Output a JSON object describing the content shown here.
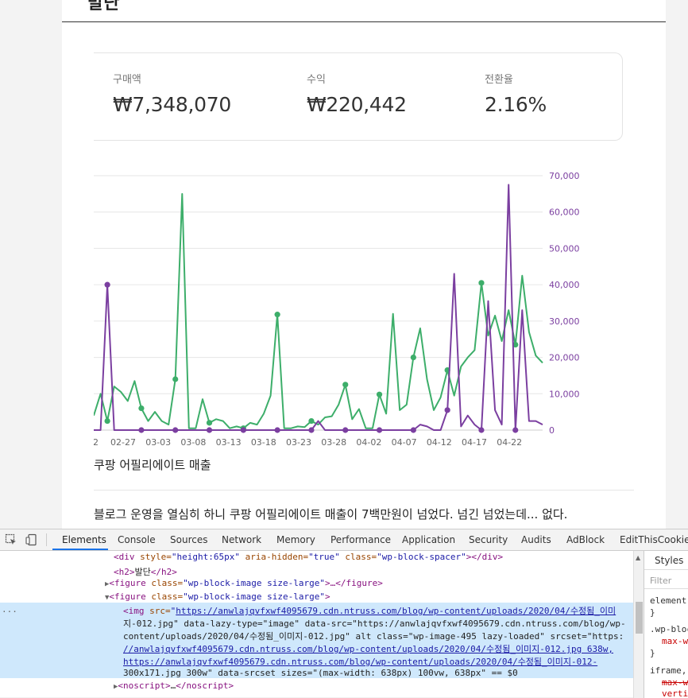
{
  "article": {
    "heading_partial": "발단",
    "stats": [
      {
        "label": "구매액",
        "value": "₩7,348,070"
      },
      {
        "label": "수익",
        "value": "₩220,442"
      },
      {
        "label": "전환율",
        "value": "2.16%"
      }
    ],
    "caption": "쿠팡 어필리에이트 매출",
    "paragraph": "블로그 운영을 열심히 하니 쿠팡 어필리에이트 매출이 7백만원이 넘었다. 넘긴 넘었는데... 없다."
  },
  "chart_data": {
    "type": "line",
    "x_ticks": [
      "2",
      "02-27",
      "03-03",
      "03-08",
      "03-13",
      "03-18",
      "03-23",
      "03-28",
      "04-02",
      "04-07",
      "04-12",
      "04-17",
      "04-22"
    ],
    "y_ticks": [
      "70,000",
      "60,000",
      "50,000",
      "40,000",
      "30,000",
      "20,000",
      "10,000",
      "0"
    ],
    "ylim": [
      0,
      70000
    ],
    "colors": {
      "green": "#3dae6a",
      "purple": "#7b3fa0",
      "tick": "#7b3fa0"
    },
    "series": [
      {
        "values": [
          4000,
          10000,
          2500,
          12000,
          10500,
          8000,
          13500,
          6000,
          2500,
          5000,
          2500,
          1500,
          14000,
          65000,
          500,
          500,
          8500,
          2000,
          3000,
          2500,
          500,
          1000,
          500,
          2000,
          1500,
          4500,
          9500,
          31800,
          500,
          500,
          1000,
          800,
          2500,
          1500,
          3500,
          3800,
          7000,
          12500,
          3000,
          5800,
          500,
          500,
          9800,
          4500,
          32000,
          5500,
          7000,
          20000,
          28000,
          14000,
          5500,
          9000,
          16500,
          9500,
          17500,
          20000,
          22000,
          40500,
          26000,
          31500,
          24500,
          33000,
          23500,
          42500,
          27000,
          20500,
          18500
        ]
      },
      {
        "values": [
          0,
          0,
          40000,
          0,
          0,
          0,
          0,
          0,
          0,
          0,
          0,
          0,
          0,
          0,
          0,
          0,
          0,
          0,
          0,
          0,
          0,
          0,
          0,
          0,
          0,
          0,
          0,
          0,
          0,
          0,
          0,
          0,
          0,
          2500,
          0,
          0,
          0,
          0,
          0,
          0,
          0,
          0,
          0,
          0,
          0,
          0,
          0,
          0,
          1500,
          1000,
          0,
          0,
          5500,
          43000,
          1000,
          4000,
          1500,
          0,
          35500,
          5500,
          1500,
          67500,
          0,
          33000,
          2500,
          2500,
          1500
        ]
      }
    ]
  },
  "devtools": {
    "tabs": [
      "Elements",
      "Console",
      "Sources",
      "Network",
      "Memory",
      "Performance",
      "Application",
      "Security",
      "Audits",
      "AdBlock",
      "EditThisCookie"
    ],
    "lines": [
      {
        "open": "<div ",
        "a1": "style=",
        "v1": "\"height:65px\"",
        "a2": " aria-hidden=",
        "v2": "\"true\"",
        "a3": " class=",
        "v3": "\"wp-block-spacer\"",
        "close": "></div>"
      },
      {
        "open": "<h2>",
        "text": "발단",
        "close": "</h2>"
      },
      {
        "arrow": "▶",
        "open": "<figure ",
        "a1": "class=",
        "v1": "\"wp-block-image size-large\"",
        "close": ">…</figure>"
      },
      {
        "arrow": "▼",
        "open": "<figure ",
        "a1": "class=",
        "v1": "\"wp-block-image size-large\"",
        "close": ">"
      },
      {
        "open": "<img ",
        "a1": "src=",
        "v1": "\"",
        "link1": "https://anwlajqvfxwf4095679.cdn.ntruss.com/blog/wp-content/uploads/2020/04/수정됨_이미",
        "tail": ""
      },
      {
        "text": "지-012.jpg\" data-lazy-type=\"image\" data-src=\"https://anwlajqvfxwf4095679.cdn.ntruss.com/blog/wp-"
      },
      {
        "text": "content/uploads/2020/04/수정됨_이미지-012.jpg\" alt class=\"wp-image-495 lazy-loaded\" srcset=\"https:"
      },
      {
        "text": "//anwlajqvfxwf4095679.cdn.ntruss.com/blog/wp-content/uploads/2020/04/수정됨_이미지-012.jpg 638w,"
      },
      {
        "text": "https://anwlajqvfxwf4095679.cdn.ntruss.com/blog/wp-content/uploads/2020/04/수정됨_이미지-012-"
      },
      {
        "text": "300x171.jpg 300w\" data-srcset sizes=\"(max-width: 638px) 100vw, 638px\" == $0"
      },
      {
        "arrow": "▶",
        "open": "<noscript>",
        "text": "…",
        "close": "</noscript>"
      }
    ],
    "styles": {
      "tab": "Styles",
      "filter": "Filter",
      "rules": [
        "element",
        "}",
        ".wp-bloc",
        "max-w",
        "}",
        "iframe,",
        "max-w",
        "verti"
      ]
    },
    "gutter_dots": "..."
  }
}
